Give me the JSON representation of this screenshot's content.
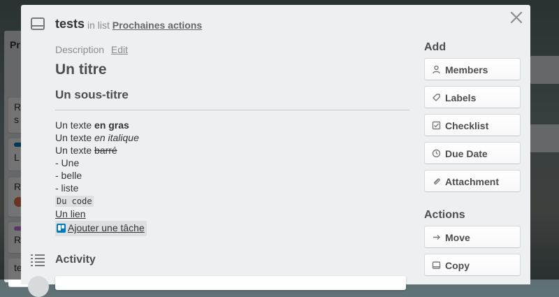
{
  "board": {
    "list_title_fragment": "Pr",
    "cards": [
      {
        "text": "R\ns",
        "label_color": ""
      },
      {
        "text": "L",
        "label_color": "#0079bf"
      },
      {
        "text": "R",
        "label_color": ""
      },
      {
        "text": "R",
        "label_color": "#c377e0"
      },
      {
        "text": "te",
        "label_color": ""
      }
    ]
  },
  "card": {
    "title": "tests",
    "in_list_prefix": "in list",
    "list_name": "Prochaines actions"
  },
  "description": {
    "label": "Description",
    "edit_label": "Edit",
    "heading1": "Un titre",
    "heading2": "Un sous-titre",
    "lines": {
      "bold_prefix": "Un texte ",
      "bold_word": "en gras",
      "italic_prefix": "Un texte ",
      "italic_word": "en italique",
      "strike_prefix": "Un texte ",
      "strike_word": "barré",
      "list_item_1": "- Une",
      "list_item_2": "- belle",
      "list_item_3": "- liste",
      "code": "Du code",
      "link": "Un lien",
      "attachment": "Ajouter une tâche"
    }
  },
  "activity": {
    "title": "Activity"
  },
  "sidebar": {
    "add_title": "Add",
    "add_buttons": [
      {
        "label": "Members",
        "icon": "person-icon"
      },
      {
        "label": "Labels",
        "icon": "tag-icon"
      },
      {
        "label": "Checklist",
        "icon": "checkbox-icon"
      },
      {
        "label": "Due Date",
        "icon": "clock-icon"
      },
      {
        "label": "Attachment",
        "icon": "paperclip-icon"
      }
    ],
    "actions_title": "Actions",
    "action_buttons": [
      {
        "label": "Move",
        "icon": "arrow-right-icon"
      },
      {
        "label": "Copy",
        "icon": "card-icon"
      }
    ]
  },
  "colors": {
    "modal_bg": "#edeff0",
    "trello_blue": "#0079bf"
  }
}
